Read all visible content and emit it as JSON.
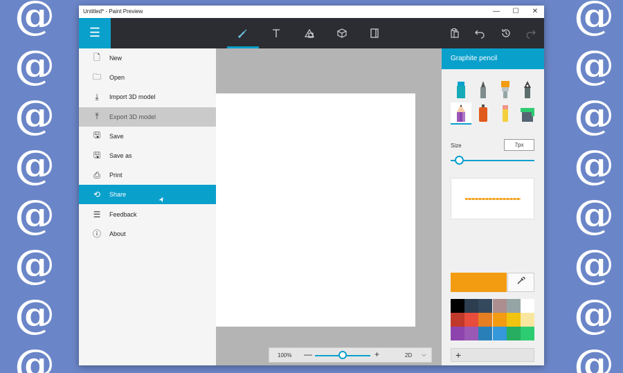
{
  "window": {
    "title": "Untitled* - Paint Preview",
    "minimize": "—",
    "maximize": "☐",
    "close": "✕"
  },
  "toolbar": {
    "menu_icon": "hamburger-menu-icon",
    "tools": [
      {
        "name": "brushes-tool",
        "icon": "brush-icon",
        "active": true
      },
      {
        "name": "text-tool",
        "icon": "text-icon"
      },
      {
        "name": "2d-shapes-tool",
        "icon": "2d-shapes-icon"
      },
      {
        "name": "3d-objects-tool",
        "icon": "3d-cube-icon"
      },
      {
        "name": "canvas-tool",
        "icon": "canvas-icon"
      }
    ],
    "actions": [
      {
        "name": "paste",
        "icon": "paste-icon"
      },
      {
        "name": "undo",
        "icon": "undo-icon"
      },
      {
        "name": "history",
        "icon": "history-icon"
      },
      {
        "name": "redo",
        "icon": "redo-icon"
      }
    ]
  },
  "menu": {
    "items": [
      {
        "id": "new",
        "label": "New",
        "icon": "new-file-icon"
      },
      {
        "id": "open",
        "label": "Open",
        "icon": "folder-icon"
      },
      {
        "id": "import-3d",
        "label": "Import 3D model",
        "icon": "import-icon"
      },
      {
        "id": "export-3d",
        "label": "Export 3D model",
        "icon": "export-icon",
        "state": "hover"
      },
      {
        "id": "save",
        "label": "Save",
        "icon": "save-icon"
      },
      {
        "id": "save-as",
        "label": "Save as",
        "icon": "save-as-icon"
      },
      {
        "id": "print",
        "label": "Print",
        "icon": "printer-icon"
      },
      {
        "id": "share",
        "label": "Share",
        "icon": "share-icon",
        "state": "selected"
      },
      {
        "id": "feedback",
        "label": "Feedback",
        "icon": "feedback-icon"
      },
      {
        "id": "about",
        "label": "About",
        "icon": "info-icon"
      }
    ]
  },
  "zoom": {
    "value": "100%",
    "minus": "—",
    "plus": "+",
    "mode": "2D",
    "level": 0.5
  },
  "panel": {
    "title": "Graphite pencil",
    "size_label": "Size",
    "size_value": "7px",
    "size_level": 0.05,
    "brushes": [
      {
        "name": "marker",
        "icon": "marker-icon"
      },
      {
        "name": "calligraphy-pen",
        "icon": "calligraphy-pen-icon"
      },
      {
        "name": "oil-brush",
        "icon": "oil-brush-icon"
      },
      {
        "name": "watercolor",
        "icon": "watercolor-icon"
      },
      {
        "name": "pencil",
        "icon": "pencil-icon",
        "selected": true
      },
      {
        "name": "spray-can",
        "icon": "spray-can-icon"
      },
      {
        "name": "crayon",
        "icon": "crayon-icon"
      },
      {
        "name": "fill",
        "icon": "fill-bucket-icon"
      }
    ],
    "current_color": "#f39c12",
    "eyedropper_icon": "eyedropper-icon",
    "add_color": "+",
    "palette": [
      "#000000",
      "#2c3e50",
      "#34495e",
      "#ac8e8e",
      "#95a5a6",
      "#ffffff",
      "#c0392b",
      "#e74c3c",
      "#e67e22",
      "#f39c12",
      "#f1c40f",
      "#f9e79f",
      "#8e44ad",
      "#9b59b6",
      "#2980b9",
      "#3498db",
      "#27ae60",
      "#2ecc71"
    ]
  },
  "colors": {
    "accent": "#0aa0cc",
    "toolbar_bg": "#2b2d32",
    "wallpaper": "#6b86c8"
  }
}
